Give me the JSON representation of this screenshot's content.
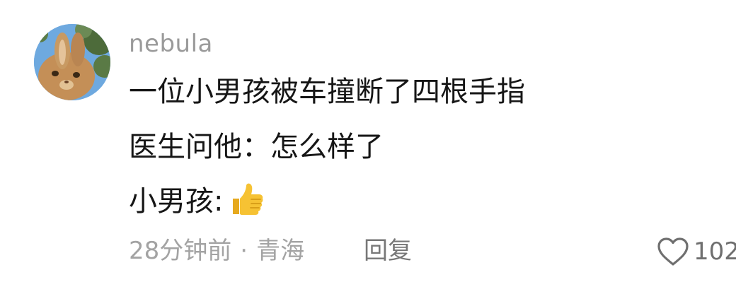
{
  "comment": {
    "username": "nebula",
    "lines": [
      "一位小男孩被车撞断了四根手指",
      "医生问他：怎么样了",
      "小男孩:"
    ],
    "emoji": "thumbs-up-icon",
    "time": "28分钟前",
    "separator": "·",
    "location": "青海",
    "reply_label": "回复",
    "like_count": "102"
  },
  "colors": {
    "username": "#9a9a9a",
    "text": "#161616",
    "meta": "#a3a3a3",
    "reply": "#777777",
    "heart": "#6f6f6f",
    "thumb": "#f6c233"
  }
}
